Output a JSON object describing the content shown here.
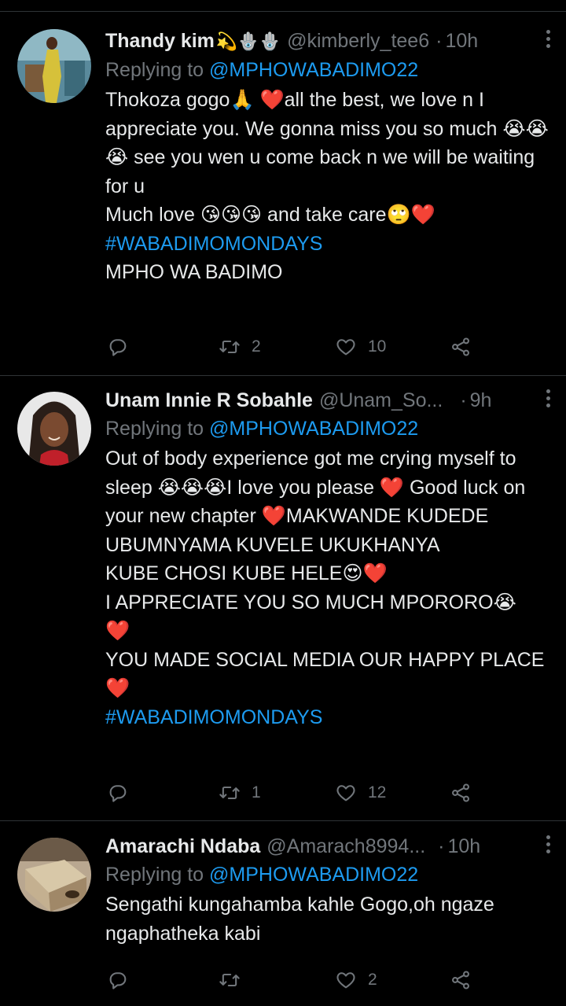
{
  "colors": {
    "background": "#000000",
    "text": "#e7e9ea",
    "muted": "#71767b",
    "link": "#1d9bf0",
    "divider": "#2f3336"
  },
  "tweets": [
    {
      "name": "Thandy kim",
      "name_emojis": "💫🪬🪬",
      "handle": "@kimberly_tee6",
      "dot": "·",
      "time": "10h",
      "replying_prefix": "Replying to",
      "replying_to": "@MPHOWABADIMO22",
      "text": "Thokoza gogo🙏 ❤️all the best, we love n I appreciate you. We gonna miss you so much 😭😭😭 see you wen u come back n we will be waiting for u\nMuch love 😘😘😘 and take care🙄❤️\n",
      "hashtag": "#WABADIMOMONDAYS",
      "text_after": "MPHO WA BADIMO",
      "reply_count": "",
      "retweet_count": "2",
      "like_count": "10",
      "icons": [
        "reply-icon",
        "retweet-icon",
        "like-icon",
        "share-icon"
      ]
    },
    {
      "name": "Unam Innie R Sobahle",
      "name_emojis": "",
      "handle": "@Unam_So...",
      "dot": "·",
      "time": "9h",
      "replying_prefix": "Replying to",
      "replying_to": "@MPHOWABADIMO22",
      "text": "Out of body experience got me crying myself to sleep 😭😭😭I love you please ❤️ Good luck on your new chapter ❤️MAKWANDE KUDEDE UBUMNYAMA KUVELE UKUKHANYA\nKUBE CHOSI KUBE HELE😍❤️\nI APPRECIATE YOU SO MUCH MPORORO😭\n❤️\nYOU MADE SOCIAL MEDIA OUR HAPPY PLACE ❤️",
      "hashtag": "#WABADIMOMONDAYS",
      "text_after": "",
      "reply_count": "",
      "retweet_count": "1",
      "like_count": "12",
      "icons": [
        "reply-icon",
        "retweet-icon",
        "like-icon",
        "share-icon"
      ]
    },
    {
      "name": "Amarachi Ndaba",
      "name_emojis": "",
      "handle": "@Amarach8994...",
      "dot": "·",
      "time": "10h",
      "replying_prefix": "Replying to",
      "replying_to": "@MPHOWABADIMO22",
      "text": "Sengathi kungahamba kahle Gogo,oh ngaze ngaphatheka kabi",
      "hashtag": "",
      "text_after": "",
      "reply_count": "",
      "retweet_count": "",
      "like_count": "2",
      "icons": [
        "reply-icon",
        "retweet-icon",
        "like-icon",
        "share-icon"
      ]
    }
  ]
}
